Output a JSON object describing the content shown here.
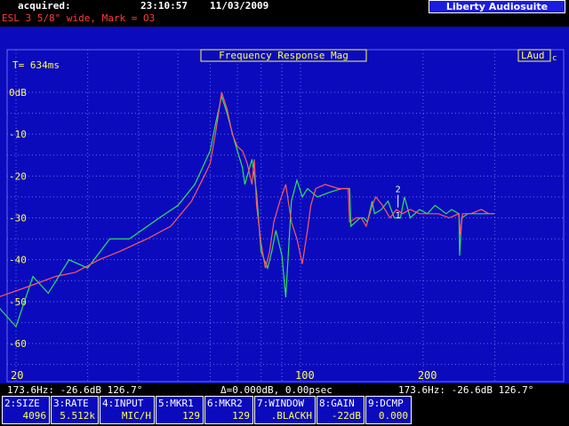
{
  "header": {
    "acquired_label": "acquired:",
    "time": "23:10:57",
    "date": "11/03/2009",
    "brand": "Liberty Audiosuite",
    "subtitle": "ESL 3 5/8\" wide, Mark = O3"
  },
  "plot": {
    "title": "Frequency Response Mag",
    "logo": "LAud",
    "logo_sub": "c",
    "time_label": "T= 634ms",
    "y_tick_labels": [
      "0dB",
      "-10",
      "-20",
      "-30",
      "-40",
      "-50",
      "-60"
    ],
    "x_tick_labels": [
      "20",
      "100",
      "200"
    ],
    "marker_label_top": "2",
    "marker_label_bottom": "1",
    "colors": {
      "background": "#0b0bbd",
      "grid": "#6a6af0",
      "trace_green": "#30e060",
      "trace_red": "#ff5a5a",
      "text_yellow": "#ffff55"
    }
  },
  "status": {
    "left": "173.6Hz: -26.6dB 126.7°",
    "center": "Δ=0.000dB, 0.00psec",
    "right": "173.6Hz: -26.6dB 126.7°"
  },
  "softkeys": [
    {
      "label": "2:SIZE",
      "value": "4096"
    },
    {
      "label": "3:RATE",
      "value": "5.512k"
    },
    {
      "label": "4:INPUT",
      "value": "MIC/H"
    },
    {
      "label": "5:MKR1",
      "value": "129"
    },
    {
      "label": "6:MKR2",
      "value": "129"
    },
    {
      "label": "7:WINDOW",
      "value": ".BLACKH"
    },
    {
      "label": "8:GAIN",
      "value": "-22dB"
    },
    {
      "label": "9:DCMP",
      "value": "0.000"
    }
  ],
  "chart_data": {
    "type": "line",
    "title": "Frequency Response Mag",
    "xlabel": "",
    "ylabel": "",
    "x_ticks": [
      "20",
      "100",
      "200"
    ],
    "ylim": [
      -70,
      5
    ],
    "series": [
      {
        "color": "#30e060",
        "points": [
          [
            15,
            -50
          ],
          [
            18,
            -51
          ],
          [
            20,
            -56
          ],
          [
            22,
            -44
          ],
          [
            24,
            -48
          ],
          [
            27,
            -40
          ],
          [
            30,
            -42
          ],
          [
            34,
            -35
          ],
          [
            38,
            -35
          ],
          [
            45,
            -30
          ],
          [
            50,
            -27
          ],
          [
            55,
            -22
          ],
          [
            60,
            -14
          ],
          [
            62,
            -7
          ],
          [
            64,
            -1
          ],
          [
            66,
            -5
          ],
          [
            69,
            -12
          ],
          [
            72,
            -18
          ],
          [
            73,
            -22
          ],
          [
            76,
            -16
          ],
          [
            78,
            -24
          ],
          [
            80,
            -38
          ],
          [
            83,
            -42
          ],
          [
            85,
            -38
          ],
          [
            87,
            -33
          ],
          [
            90,
            -39
          ],
          [
            92,
            -49
          ],
          [
            95,
            -26
          ],
          [
            98,
            -21
          ],
          [
            101,
            -25
          ],
          [
            104,
            -23
          ],
          [
            110,
            -25
          ],
          [
            117,
            -24
          ],
          [
            126,
            -23
          ],
          [
            132,
            -23
          ],
          [
            133,
            -32
          ],
          [
            140,
            -30
          ],
          [
            143,
            -30
          ],
          [
            146,
            -31
          ],
          [
            150,
            -26
          ],
          [
            152,
            -29
          ],
          [
            158,
            -28
          ],
          [
            164,
            -26
          ],
          [
            170,
            -30
          ],
          [
            176,
            -30
          ],
          [
            180,
            -25
          ],
          [
            186,
            -30
          ],
          [
            196,
            -28
          ],
          [
            205,
            -29
          ],
          [
            214,
            -27
          ],
          [
            228,
            -29
          ],
          [
            235,
            -28
          ],
          [
            245,
            -29
          ],
          [
            246,
            -39
          ],
          [
            249,
            -30
          ],
          [
            258,
            -29
          ],
          [
            270,
            -29
          ],
          [
            284,
            -29
          ],
          [
            300,
            -29
          ]
        ]
      },
      {
        "color": "#ff5a5a",
        "points": [
          [
            15,
            -46
          ],
          [
            18,
            -49
          ],
          [
            22,
            -46
          ],
          [
            25,
            -44
          ],
          [
            28,
            -43
          ],
          [
            32,
            -40
          ],
          [
            36,
            -38
          ],
          [
            42,
            -35
          ],
          [
            48,
            -32
          ],
          [
            54,
            -26
          ],
          [
            58,
            -20
          ],
          [
            60,
            -17
          ],
          [
            62,
            -9
          ],
          [
            64,
            0
          ],
          [
            66,
            -4
          ],
          [
            68,
            -10
          ],
          [
            70,
            -13
          ],
          [
            72,
            -14
          ],
          [
            74,
            -17
          ],
          [
            76,
            -22
          ],
          [
            77,
            -16
          ],
          [
            78,
            -27
          ],
          [
            80,
            -36
          ],
          [
            82,
            -42
          ],
          [
            84,
            -38
          ],
          [
            86,
            -31
          ],
          [
            89,
            -26
          ],
          [
            92,
            -22
          ],
          [
            95,
            -31
          ],
          [
            98,
            -35
          ],
          [
            101,
            -41
          ],
          [
            104,
            -33
          ],
          [
            106,
            -27
          ],
          [
            109,
            -23
          ],
          [
            115,
            -22
          ],
          [
            124,
            -23
          ],
          [
            131,
            -23
          ],
          [
            132,
            -31
          ],
          [
            137,
            -30
          ],
          [
            141,
            -30
          ],
          [
            145,
            -32
          ],
          [
            150,
            -27
          ],
          [
            153,
            -25
          ],
          [
            159,
            -27
          ],
          [
            166,
            -30
          ],
          [
            172,
            -28
          ],
          [
            178,
            -29
          ],
          [
            186,
            -28
          ],
          [
            196,
            -29
          ],
          [
            206,
            -29
          ],
          [
            218,
            -29
          ],
          [
            232,
            -30
          ],
          [
            245,
            -29
          ],
          [
            247,
            -34
          ],
          [
            250,
            -29
          ],
          [
            262,
            -29
          ],
          [
            278,
            -28
          ],
          [
            290,
            -29
          ],
          [
            300,
            -29
          ]
        ]
      }
    ]
  }
}
